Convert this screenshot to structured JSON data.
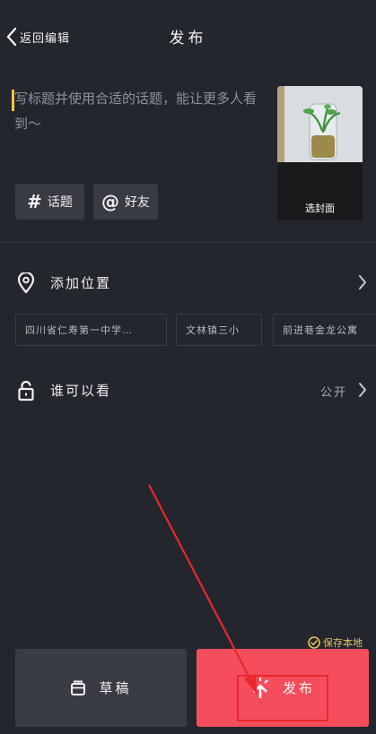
{
  "header": {
    "back_label": "返回编辑",
    "title": "发布"
  },
  "caption": {
    "placeholder": "写标题并使用合适的话题，能让更多人看到～"
  },
  "cover": {
    "label": "选封面"
  },
  "tags": {
    "topic": {
      "symbol": "#",
      "label": "话题"
    },
    "friend": {
      "symbol": "@",
      "label": "好友"
    }
  },
  "location": {
    "label": "添加位置",
    "suggestions": [
      "四川省仁寿第一中学…",
      "文林镇三小",
      "前进巷金龙公寓"
    ]
  },
  "visibility": {
    "label": "谁可以看",
    "value": "公开"
  },
  "save_local": {
    "label": "保存本地",
    "checked": true
  },
  "footer": {
    "draft_label": "草稿",
    "publish_label": "发布"
  },
  "colors": {
    "background": "#24262e",
    "publish": "#f64d5d",
    "accent": "#f5c544",
    "annotation": "#e8282b"
  }
}
